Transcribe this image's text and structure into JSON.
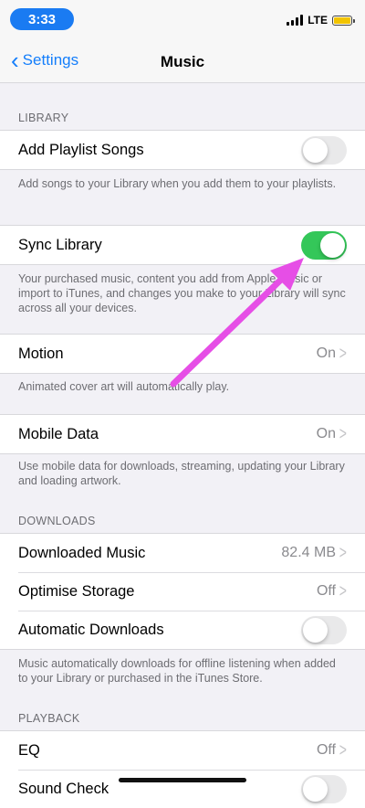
{
  "status": {
    "time": "3:33",
    "network": "LTE"
  },
  "nav": {
    "back_label": "Settings",
    "title": "Music"
  },
  "sections": {
    "library": "LIBRARY",
    "downloads": "DOWNLOADS",
    "playback": "PLAYBACK"
  },
  "rows": {
    "add_playlist_songs": {
      "label": "Add Playlist Songs",
      "on": false
    },
    "sync_library": {
      "label": "Sync Library",
      "on": true
    },
    "motion": {
      "label": "Motion",
      "value": "On"
    },
    "mobile_data": {
      "label": "Mobile Data",
      "value": "On"
    },
    "downloaded_music": {
      "label": "Downloaded Music",
      "value": "82.4 MB"
    },
    "optimise_storage": {
      "label": "Optimise Storage",
      "value": "Off"
    },
    "automatic_downloads": {
      "label": "Automatic Downloads",
      "on": false
    },
    "eq": {
      "label": "EQ",
      "value": "Off"
    },
    "sound_check": {
      "label": "Sound Check",
      "on": false
    }
  },
  "footers": {
    "add_playlist_songs": "Add songs to your Library when you add them to your playlists.",
    "sync_library": "Your purchased music, content you add from Apple Music or import to iTunes, and changes you make to your Library will sync across all your devices.",
    "motion": "Animated cover art will automatically play.",
    "mobile_data": "Use mobile data for downloads, streaming, updating your Library and loading artwork.",
    "automatic_downloads": "Music automatically downloads for offline listening when added to your Library or purchased in the iTunes Store."
  },
  "colors": {
    "accent": "#147efb",
    "toggle_on": "#34c759",
    "annotation_arrow": "#e64ee6"
  }
}
